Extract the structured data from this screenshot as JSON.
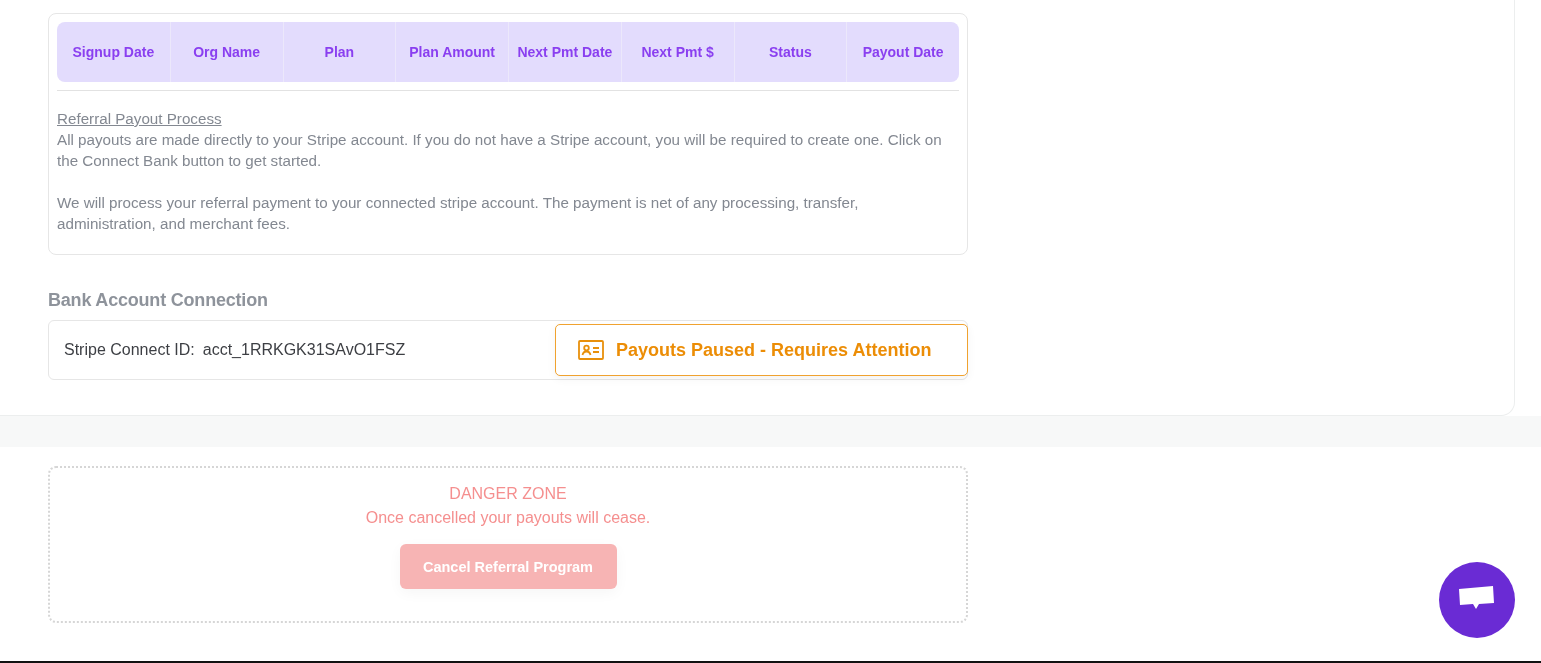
{
  "signups_table": {
    "columns": [
      "Signup Date",
      "Org Name",
      "Plan",
      "Plan Amount",
      "Next Pmt Date",
      "Next Pmt $",
      "Status",
      "Payout Date"
    ]
  },
  "payout_process": {
    "title": "Referral Payout Process",
    "paragraphs": [
      "All payouts are made directly to your Stripe account. If you do not have a Stripe account, you will be required to create one. Click on the Connect Bank button to get started.",
      "We will process your referral payment to your connected stripe account. The payment is net of any processing, transfer, administration, and merchant fees."
    ]
  },
  "bank_connection": {
    "heading": "Bank Account Connection",
    "label": "Stripe Connect ID:",
    "value": "acct_1RRKGK31SAvO1FSZ",
    "status_button": "Payouts Paused - Requires Attention"
  },
  "danger_zone": {
    "title": "DANGER ZONE",
    "message": "Once cancelled your payouts will cease.",
    "button": "Cancel Referral Program",
    "disabled": true
  }
}
